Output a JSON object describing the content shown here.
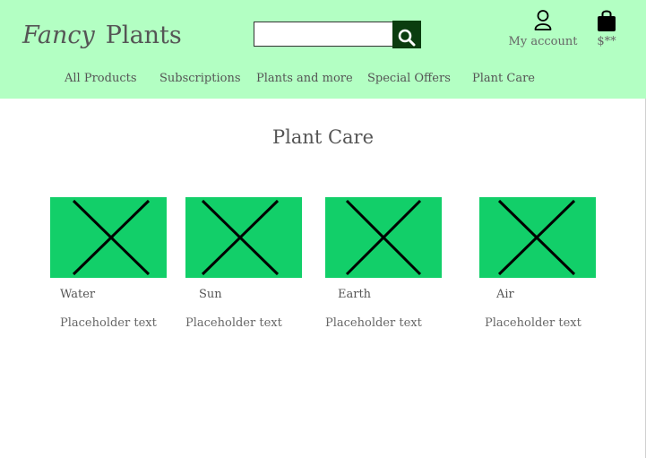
{
  "brand": {
    "part1": "Fancy",
    "part2": "Plants"
  },
  "search": {
    "value": "",
    "placeholder": ""
  },
  "header": {
    "account_label": "My account",
    "cart_label": "$**"
  },
  "nav": [
    "All Products",
    "Subscriptions",
    "Plants and more",
    "Special Offers",
    "Plant Care"
  ],
  "page": {
    "title": "Plant Care"
  },
  "cards": [
    {
      "name": "Water",
      "text": "Placeholder text"
    },
    {
      "name": "Sun",
      "text": "Placeholder text"
    },
    {
      "name": "Earth",
      "text": "Placeholder text"
    },
    {
      "name": "Air",
      "text": "Placeholder text"
    }
  ],
  "colors": {
    "header_bg": "#b3ffc3",
    "search_button": "#0b3d0f",
    "image_placeholder": "#12cf69"
  },
  "icons": [
    "search-icon",
    "account-icon",
    "shopping-bag-icon",
    "image-placeholder-icon"
  ]
}
